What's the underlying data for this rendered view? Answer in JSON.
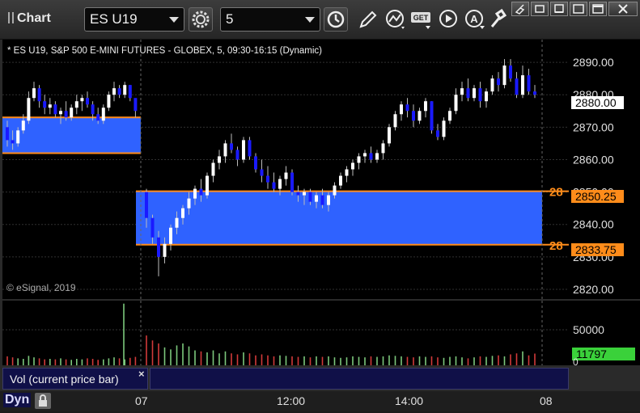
{
  "toolbar": {
    "title": "Chart",
    "symbol": "ES U19",
    "interval": "5"
  },
  "chart": {
    "header": "* ES U19, S&P 500 E-MINI FUTURES - GLOBEX, 5, 09:30-16:15 (Dynamic)",
    "copyright": "© eSignal, 2019",
    "price_ticks": [
      "2890.00",
      "2880.00",
      "2870.00",
      "2860.00",
      "2850.00",
      "2840.00",
      "2830.00",
      "2820.00"
    ],
    "last_price": "2880.00",
    "upper_level": "2850.25",
    "lower_level": "2833.75",
    "upper_level_label": "28",
    "lower_level_label": "28",
    "vol_ticks": [
      "50000",
      "0"
    ],
    "vol_value": "11797",
    "time_labels": [
      "07",
      "12:00",
      "14:00",
      "08"
    ],
    "colors": {
      "up": "#ffffff",
      "down": "#1a1aff",
      "zone": "#2f62ff",
      "level": "#ff8c1a",
      "vol_up": "#7cc87c",
      "vol_down": "#d23a3a",
      "last_bg": "#ffffff",
      "vol_bg": "#3ad13a"
    }
  },
  "legend": {
    "vol_label": "Vol (current price bar)",
    "close": "×",
    "mode": "Dyn"
  },
  "chart_data": {
    "type": "candlestick",
    "symbol": "ES U19",
    "price_ylim": [
      2817,
      2897
    ],
    "bars_prev_day": [
      [
        2870,
        2872,
        2864,
        2866
      ],
      [
        2866,
        2869,
        2863,
        2865
      ],
      [
        2865,
        2870,
        2864,
        2869
      ],
      [
        2869,
        2874,
        2868,
        2872
      ],
      [
        2872,
        2881,
        2871,
        2879
      ],
      [
        2879,
        2884,
        2878,
        2882
      ],
      [
        2882,
        2883,
        2876,
        2878
      ],
      [
        2878,
        2880,
        2874,
        2876
      ],
      [
        2876,
        2879,
        2874,
        2877
      ],
      [
        2877,
        2878,
        2873,
        2874
      ],
      [
        2874,
        2876,
        2871,
        2875
      ],
      [
        2875,
        2878,
        2872,
        2873
      ],
      [
        2873,
        2877,
        2872,
        2876
      ],
      [
        2876,
        2880,
        2874,
        2878
      ],
      [
        2878,
        2880,
        2875,
        2879
      ],
      [
        2879,
        2881,
        2876,
        2877
      ],
      [
        2877,
        2878,
        2872,
        2874
      ],
      [
        2874,
        2876,
        2871,
        2872
      ],
      [
        2872,
        2877,
        2871,
        2876
      ],
      [
        2876,
        2881,
        2875,
        2880
      ],
      [
        2880,
        2884,
        2878,
        2882
      ],
      [
        2882,
        2883,
        2879,
        2880
      ],
      [
        2880,
        2884,
        2879,
        2883
      ],
      [
        2883,
        2883,
        2878,
        2879
      ],
      [
        2879,
        2878,
        2873,
        2875
      ]
    ],
    "bars_today": [
      [
        2850,
        2851,
        2839,
        2842
      ],
      [
        2842,
        2843,
        2834,
        2836
      ],
      [
        2836,
        2838,
        2824,
        2830
      ],
      [
        2830,
        2836,
        2828,
        2834
      ],
      [
        2834,
        2840,
        2832,
        2839
      ],
      [
        2839,
        2844,
        2837,
        2842
      ],
      [
        2842,
        2846,
        2840,
        2845
      ],
      [
        2845,
        2850,
        2843,
        2848
      ],
      [
        2848,
        2852,
        2846,
        2851
      ],
      [
        2851,
        2854,
        2847,
        2849
      ],
      [
        2849,
        2856,
        2848,
        2855
      ],
      [
        2855,
        2860,
        2853,
        2859
      ],
      [
        2859,
        2863,
        2857,
        2861
      ],
      [
        2861,
        2866,
        2859,
        2865
      ],
      [
        2865,
        2868,
        2862,
        2863
      ],
      [
        2863,
        2864,
        2858,
        2860
      ],
      [
        2860,
        2867,
        2859,
        2866
      ],
      [
        2866,
        2867,
        2860,
        2861
      ],
      [
        2861,
        2862,
        2856,
        2857
      ],
      [
        2857,
        2860,
        2853,
        2855
      ],
      [
        2855,
        2858,
        2851,
        2853
      ],
      [
        2853,
        2856,
        2850,
        2851
      ],
      [
        2851,
        2855,
        2849,
        2854
      ],
      [
        2854,
        2858,
        2852,
        2856
      ],
      [
        2856,
        2857,
        2849,
        2850
      ],
      [
        2850,
        2852,
        2847,
        2849
      ],
      [
        2849,
        2851,
        2846,
        2850
      ],
      [
        2850,
        2851,
        2846,
        2847
      ],
      [
        2847,
        2850,
        2845,
        2849
      ],
      [
        2849,
        2851,
        2845,
        2846
      ],
      [
        2846,
        2850,
        2844,
        2849
      ],
      [
        2849,
        2853,
        2848,
        2852
      ],
      [
        2852,
        2856,
        2851,
        2855
      ],
      [
        2855,
        2858,
        2853,
        2857
      ],
      [
        2857,
        2860,
        2855,
        2859
      ],
      [
        2859,
        2862,
        2857,
        2861
      ],
      [
        2861,
        2863,
        2859,
        2862
      ],
      [
        2862,
        2864,
        2859,
        2860
      ],
      [
        2860,
        2863,
        2859,
        2862
      ],
      [
        2862,
        2866,
        2860,
        2865
      ],
      [
        2865,
        2871,
        2864,
        2870
      ],
      [
        2870,
        2875,
        2869,
        2874
      ],
      [
        2874,
        2878,
        2872,
        2877
      ],
      [
        2877,
        2879,
        2873,
        2875
      ],
      [
        2875,
        2877,
        2870,
        2872
      ],
      [
        2872,
        2876,
        2871,
        2875
      ],
      [
        2875,
        2879,
        2873,
        2878
      ],
      [
        2878,
        2878,
        2868,
        2869
      ],
      [
        2869,
        2871,
        2866,
        2867
      ],
      [
        2867,
        2873,
        2866,
        2872
      ],
      [
        2872,
        2876,
        2871,
        2875
      ],
      [
        2875,
        2882,
        2874,
        2880
      ],
      [
        2880,
        2884,
        2878,
        2882
      ],
      [
        2882,
        2885,
        2878,
        2879
      ],
      [
        2879,
        2883,
        2878,
        2882
      ],
      [
        2882,
        2884,
        2876,
        2878
      ],
      [
        2878,
        2882,
        2876,
        2881
      ],
      [
        2881,
        2886,
        2880,
        2885
      ],
      [
        2885,
        2887,
        2881,
        2883
      ],
      [
        2883,
        2891,
        2882,
        2889
      ],
      [
        2889,
        2891,
        2884,
        2885
      ],
      [
        2885,
        2887,
        2879,
        2880
      ],
      [
        2880,
        2889,
        2879,
        2886
      ],
      [
        2886,
        2888,
        2880,
        2881
      ],
      [
        2881,
        2883,
        2879,
        2880
      ]
    ],
    "volume_prev_day": [
      9000,
      8000,
      7000,
      6500,
      9500,
      8000,
      7000,
      6000,
      6500,
      6000,
      7000,
      6000,
      5500,
      6500,
      6000,
      7000,
      6500,
      5500,
      6000,
      7000,
      8000,
      7000,
      6000,
      7500,
      8500
    ],
    "volume_today": [
      30000,
      25000,
      22000,
      18000,
      16000,
      20000,
      22000,
      19000,
      15000,
      14000,
      13000,
      15000,
      12000,
      14000,
      12000,
      11000,
      13000,
      12000,
      10000,
      11000,
      10000,
      9000,
      10000,
      9500,
      9000,
      8500,
      9000,
      8000,
      9000,
      8500,
      9000,
      8000,
      7500,
      8000,
      9000,
      8500,
      8000,
      9000,
      8500,
      9000,
      10000,
      9500,
      9000,
      8500,
      8000,
      9000,
      8500,
      9000,
      8000,
      7500,
      8500,
      9000,
      8000,
      7000,
      8000,
      9000,
      8500,
      9500,
      10000,
      9000,
      11000,
      12000,
      14000,
      10000,
      11797
    ],
    "volume_spike": 62000,
    "volume_ylim": [
      0,
      65000
    ]
  }
}
